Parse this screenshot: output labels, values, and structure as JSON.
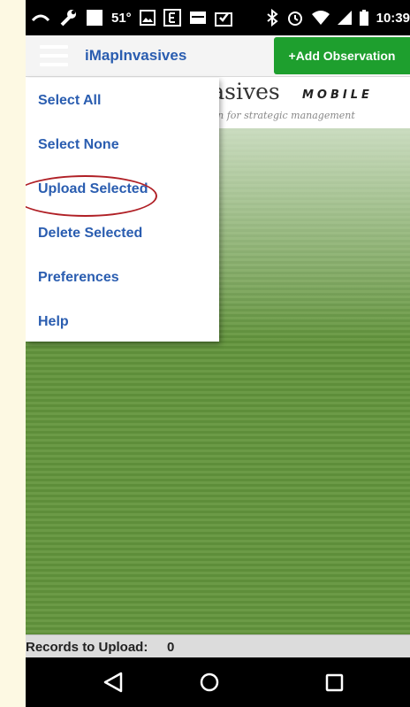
{
  "status_bar": {
    "temperature": "51°",
    "time": "10:39",
    "icons": [
      "recents-arrow-icon",
      "wrench-icon",
      "square-icon",
      "image-icon",
      "e-news-icon",
      "mail-icon",
      "check-photo-icon",
      "bluetooth-icon",
      "alarm-icon",
      "wifi-icon",
      "signal-icon",
      "battery-icon"
    ]
  },
  "app_bar": {
    "title": "iMapInvasives",
    "add_button_label": "+Add Observation",
    "menu_icon": "hamburger-icon",
    "colors": {
      "title": "#2a5db0",
      "add_button": "#1e9f2e"
    }
  },
  "banner": {
    "logo_text": "nvasives",
    "mobile_text": "MOBILE",
    "tagline": "ation for strategic management"
  },
  "menu": {
    "items": [
      {
        "label": "Select All"
      },
      {
        "label": "Select None"
      },
      {
        "label": "Upload Selected"
      },
      {
        "label": "Delete Selected"
      },
      {
        "label": "Preferences",
        "highlighted": true
      },
      {
        "label": "Help"
      }
    ],
    "highlight_color": "#b02026"
  },
  "footer": {
    "records_label": "Records to Upload:",
    "records_count": "0"
  },
  "nav_bar": {
    "buttons": [
      "back-triangle-icon",
      "home-circle-icon",
      "recents-square-icon"
    ]
  }
}
